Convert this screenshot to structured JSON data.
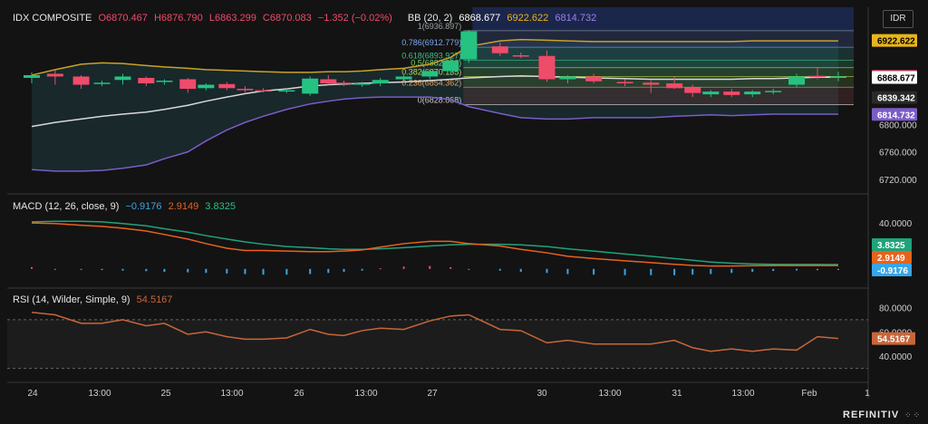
{
  "header": {
    "symbol": "IDX COMPOSITE",
    "open": "O6870.467",
    "high": "H6876.790",
    "low": "L6863.299",
    "close": "C6870.083",
    "change": "−1.352 (−0.02%)",
    "bb_label": "BB (20, 2)",
    "bb_mid": "6868.677",
    "bb_upper": "6922.622",
    "bb_lower": "6814.732"
  },
  "currency": "IDR",
  "brand": "REFINITIV",
  "brand_dots": "⁘⁘",
  "colors": {
    "up": "#26c281",
    "down": "#ef4b6a",
    "bb_upper": "#c9a227",
    "bb_mid": "#d8d8d8",
    "bb_lower": "#7b5cc8",
    "macd": "#e8621c",
    "signal": "#1fa37a",
    "rsi": "#c8663a",
    "hist": "#37a6e8"
  },
  "price_axis": {
    "ticks": [
      "6800.000",
      "6760.000",
      "6720.000"
    ],
    "ymin": 6704,
    "ymax": 6942
  },
  "time_axis": [
    "24",
    "13:00",
    "25",
    "13:00",
    "26",
    "13:00",
    "27",
    "30",
    "13:00",
    "31",
    "13:00",
    "Feb",
    "1"
  ],
  "price_badges": [
    {
      "value": "6922.622",
      "bg": "#e8b51c",
      "fg": "#000000"
    },
    {
      "value": "6870.083",
      "bg": "#ef4b6a",
      "fg": "#ffffff"
    },
    {
      "value": "6868.677",
      "bg": "#ffffff",
      "fg": "#000000"
    },
    {
      "value": "6839.342",
      "bg": "#2a2a2a",
      "fg": "#ffffff"
    },
    {
      "value": "6814.732",
      "bg": "#7b5cc8",
      "fg": "#ffffff"
    }
  ],
  "fib_levels": [
    {
      "ratio": "1",
      "price": "(6936.897)",
      "value": 6936.897,
      "label": "1(6936.897)"
    },
    {
      "ratio": "0.786",
      "price": "(6912.779)",
      "value": 6912.779,
      "label": "0.786(6912.779)"
    },
    {
      "ratio": "0.618",
      "price": "(6893.927)",
      "value": 6893.927,
      "label": "0.618(6893.927)"
    },
    {
      "ratio": "0.5",
      "price": "(6882.882)",
      "value": 6882.882,
      "label": "0.5(6882.882)"
    },
    {
      "ratio": "0.382",
      "price": "(6870.135)",
      "value": 6870.135,
      "label": "0.382(6870.135)"
    },
    {
      "ratio": "0.236",
      "price": "(6854.362)",
      "value": 6854.362,
      "label": "0.236(6854.362)"
    },
    {
      "ratio": "0",
      "price": "(6828.868)",
      "value": 6828.868,
      "label": "0(6828.868)"
    }
  ],
  "macd": {
    "label": "MACD (12, 26, close, 9)",
    "macd_value": "−0.9176",
    "signal_value": "2.9149",
    "hist_value": "3.8325",
    "ticks": [
      "40.0000"
    ],
    "ymin": -12,
    "ymax": 48,
    "badges": [
      {
        "value": "3.8325",
        "bg": "#1fa37a",
        "fg": "#ffffff"
      },
      {
        "value": "2.9149",
        "bg": "#e8621c",
        "fg": "#ffffff"
      },
      {
        "value": "-0.9176",
        "bg": "#37a6e8",
        "fg": "#ffffff"
      }
    ]
  },
  "rsi": {
    "label": "RSI (14, Wilder, Simple, 9)",
    "value": "54.5167",
    "ticks": [
      "80.0000",
      "60.0000",
      "40.0000"
    ],
    "ymin": 20,
    "ymax": 90,
    "upper": 70,
    "lower": 30,
    "badge": {
      "value": "54.5167",
      "bg": "#c8663a",
      "fg": "#ffffff"
    }
  },
  "chart_data": {
    "type": "candlestick",
    "title": "IDX COMPOSITE",
    "candles": [
      [
        6868,
        6876,
        6860,
        6872
      ],
      [
        6874,
        6880,
        6858,
        6870
      ],
      [
        6870,
        6872,
        6852,
        6858
      ],
      [
        6860,
        6864,
        6856,
        6861
      ],
      [
        6865,
        6874,
        6858,
        6870
      ],
      [
        6868,
        6870,
        6856,
        6860
      ],
      [
        6862,
        6866,
        6858,
        6864
      ],
      [
        6866,
        6868,
        6846,
        6852
      ],
      [
        6853,
        6860,
        6850,
        6858
      ],
      [
        6859,
        6862,
        6850,
        6853
      ],
      [
        6852,
        6856,
        6847,
        6850
      ],
      [
        6850,
        6853,
        6847,
        6849
      ],
      [
        6850,
        6852,
        6846,
        6850
      ],
      [
        6845,
        6870,
        6842,
        6867
      ],
      [
        6866,
        6872,
        6858,
        6860
      ],
      [
        6861,
        6864,
        6856,
        6859
      ],
      [
        6858,
        6862,
        6855,
        6860
      ],
      [
        6860,
        6868,
        6856,
        6865
      ],
      [
        6866,
        6872,
        6862,
        6870
      ],
      [
        6870,
        6880,
        6866,
        6878
      ],
      [
        6878,
        6898,
        6872,
        6893
      ],
      [
        6895,
        6938,
        6890,
        6936
      ],
      [
        6914,
        6920,
        6900,
        6904
      ],
      [
        6901,
        6905,
        6897,
        6900
      ],
      [
        6900,
        6908,
        6862,
        6866
      ],
      [
        6866,
        6872,
        6860,
        6870
      ],
      [
        6870,
        6874,
        6860,
        6863
      ],
      [
        6862,
        6866,
        6856,
        6860
      ],
      [
        6861,
        6864,
        6846,
        6858
      ],
      [
        6860,
        6870,
        6852,
        6853
      ],
      [
        6854,
        6858,
        6840,
        6846
      ],
      [
        6844,
        6850,
        6840,
        6848
      ],
      [
        6848,
        6852,
        6840,
        6843
      ],
      [
        6844,
        6850,
        6840,
        6848
      ],
      [
        6848,
        6852,
        6844,
        6849
      ],
      [
        6858,
        6874,
        6854,
        6870
      ],
      [
        6871,
        6884,
        6866,
        6870
      ],
      [
        6870,
        6877,
        6863,
        6870
      ]
    ],
    "x_positions": [
      0.0,
      0.045,
      0.095,
      0.135,
      0.175,
      0.22,
      0.255,
      0.3,
      0.335,
      0.375,
      0.41,
      0.445,
      0.49,
      0.535,
      0.57,
      0.6,
      0.635,
      0.67,
      0.715,
      0.765,
      0.805,
      0.84,
      0.9,
      0.94,
      0.99,
      1.03,
      1.08,
      1.14,
      1.19,
      1.235,
      1.27,
      1.305,
      1.345,
      1.385,
      1.425,
      1.47,
      1.51,
      1.55
    ],
    "bb_upper": [
      6872,
      6880,
      6888,
      6890,
      6889,
      6886,
      6884,
      6882,
      6880,
      6879,
      6878,
      6877,
      6876,
      6876,
      6877,
      6877,
      6878,
      6880,
      6882,
      6888,
      6898,
      6914,
      6922,
      6924,
      6923,
      6922,
      6921,
      6921,
      6921,
      6921,
      6921,
      6921,
      6921,
      6922,
      6922,
      6922,
      6922,
      6922
    ],
    "bb_mid": [
      6797,
      6803,
      6808,
      6812,
      6815,
      6818,
      6822,
      6828,
      6834,
      6840,
      6845,
      6849,
      6852,
      6856,
      6858,
      6859,
      6860,
      6861,
      6862,
      6864,
      6866,
      6868,
      6870,
      6871,
      6870,
      6869,
      6868,
      6867,
      6866,
      6866,
      6866,
      6866,
      6866,
      6867,
      6867,
      6868,
      6869,
      6869
    ],
    "bb_lower": [
      6734,
      6732,
      6732,
      6733,
      6736,
      6741,
      6750,
      6760,
      6776,
      6792,
      6803,
      6812,
      6822,
      6830,
      6834,
      6837,
      6839,
      6840,
      6840,
      6840,
      6836,
      6826,
      6816,
      6810,
      6808,
      6808,
      6810,
      6810,
      6810,
      6812,
      6813,
      6814,
      6813,
      6814,
      6815,
      6815,
      6815,
      6815
    ],
    "macd_line": [
      40,
      39.5,
      38,
      37,
      35.5,
      33,
      30,
      26,
      22,
      18,
      16,
      16,
      15.5,
      15,
      15,
      15.5,
      16.5,
      19,
      22,
      24,
      24,
      22,
      20,
      17,
      14,
      11,
      9,
      7,
      5.5,
      4,
      3,
      2.5,
      2.5,
      2.8,
      2.9,
      2.9,
      2.9,
      2.9
    ],
    "signal_line": [
      41,
      41.5,
      41.5,
      41,
      39.5,
      37.5,
      35,
      32,
      29,
      26,
      23.5,
      21.5,
      19.5,
      18.5,
      17.5,
      17,
      17,
      17.5,
      18.5,
      20,
      21,
      21.5,
      21.5,
      21,
      19.5,
      17.5,
      15.5,
      13,
      11,
      9,
      7.5,
      6,
      5,
      4.3,
      4,
      3.9,
      3.85,
      3.8
    ],
    "macd_hist": [
      1.5,
      -0.5,
      -0.8,
      -1,
      -1.5,
      -2,
      -2.5,
      -3,
      -3.5,
      -4,
      -4.5,
      -5,
      -5,
      -4.5,
      -3.5,
      -2.5,
      -1.5,
      0.5,
      2,
      2.5,
      1.5,
      -0.5,
      -1.5,
      -2.5,
      -3.5,
      -4.5,
      -5,
      -5.5,
      -5.5,
      -5.5,
      -5,
      -4.5,
      -3.5,
      -2.5,
      -1.8,
      -1.4,
      -1.1,
      -0.9
    ],
    "rsi": [
      76,
      74,
      67,
      67,
      70,
      65,
      67,
      58,
      60,
      56,
      54,
      54,
      55,
      62,
      58,
      57,
      61,
      63,
      62,
      69,
      73,
      74,
      62,
      61,
      51,
      53,
      50,
      50,
      50,
      53,
      47,
      44,
      46,
      44,
      46,
      45,
      56,
      54.5
    ]
  }
}
